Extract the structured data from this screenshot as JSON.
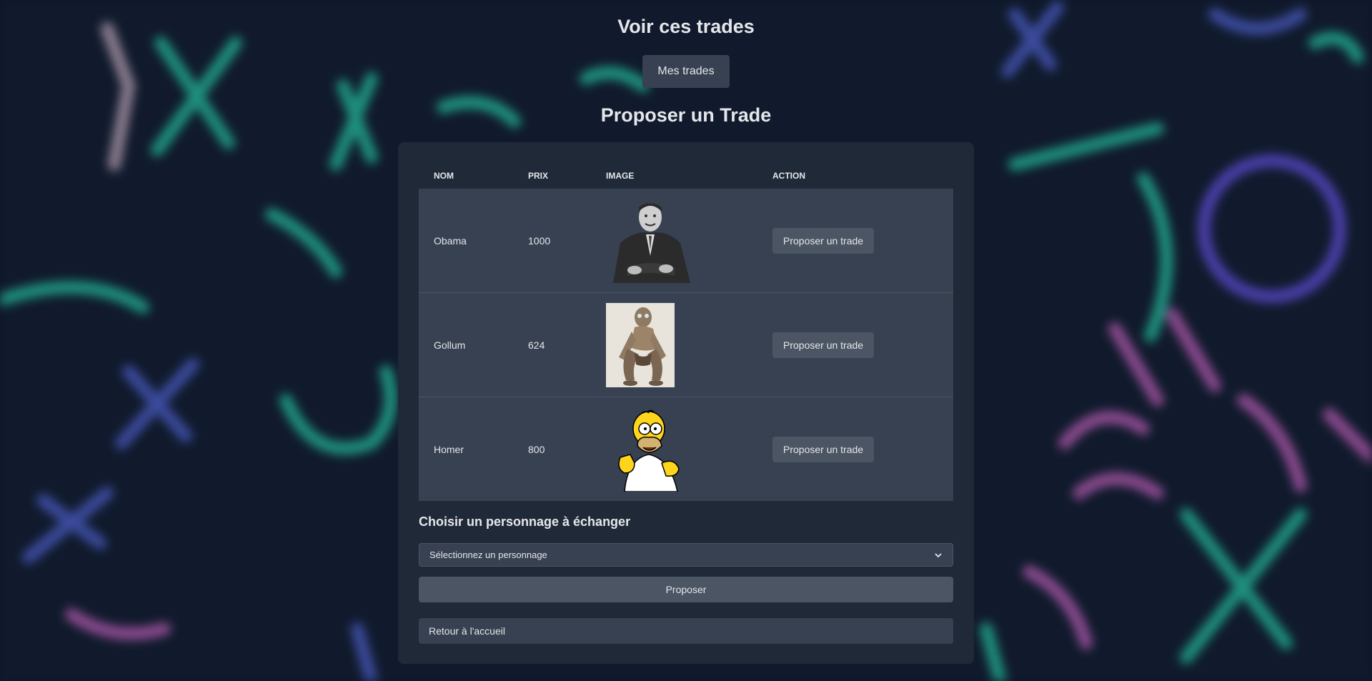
{
  "header": {
    "title": "Voir ces trades",
    "my_trades_label": "Mes trades",
    "subtitle": "Proposer un Trade"
  },
  "table": {
    "columns": [
      "Nom",
      "Prix",
      "Image",
      "Action"
    ],
    "rows": [
      {
        "nom": "Obama",
        "prix": "1000",
        "image": "obama-portrait",
        "action": "Proposer un trade"
      },
      {
        "nom": "Gollum",
        "prix": "624",
        "image": "gollum-figure",
        "action": "Proposer un trade"
      },
      {
        "nom": "Homer",
        "prix": "800",
        "image": "homer-simpson-figure",
        "action": "Proposer un trade"
      }
    ]
  },
  "form": {
    "choose_label": "Choisir un personnage à échanger",
    "select_placeholder": "Sélectionnez un personnage",
    "submit_label": "Proposer"
  },
  "footer": {
    "back_label": "Retour à l'accueil"
  },
  "colors": {
    "page_bg": "#0f1729",
    "card_bg": "#1f2937",
    "row_bg": "#374151",
    "button_bg": "#4b5563"
  }
}
